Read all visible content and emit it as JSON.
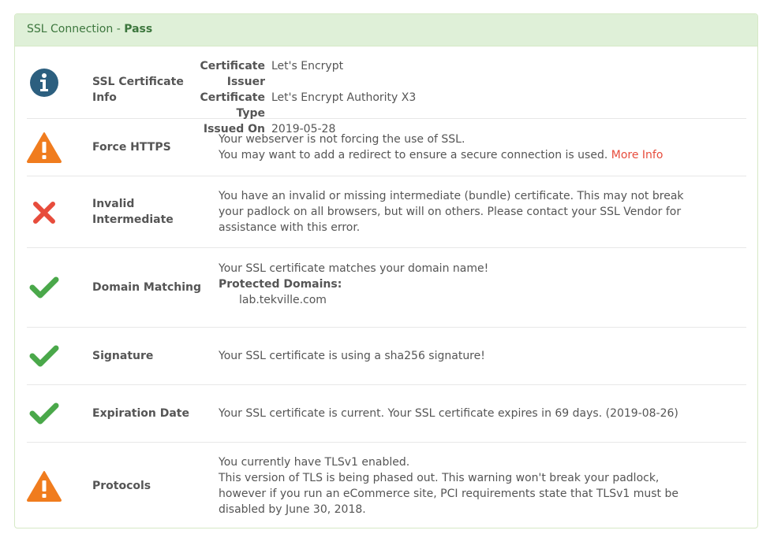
{
  "panel": {
    "title": "SSL Connection -",
    "status": "Pass"
  },
  "colors": {
    "info": "#2c5f7f",
    "warning": "#f07c1e",
    "error": "#e74c3c",
    "success": "#4aa84a",
    "link": "#e74c3c"
  },
  "rows": {
    "cert_info": {
      "icon": "info-icon",
      "label": "SSL Certificate Info",
      "fields": {
        "issuer_key": "Certificate Issuer",
        "issuer_value": "Let's Encrypt",
        "type_key": "Certificate Type",
        "type_value": "Let's Encrypt Authority X3",
        "issued_key": "Issued On",
        "issued_value": "2019-05-28"
      }
    },
    "force_https": {
      "icon": "warning-icon",
      "label": "Force HTTPS",
      "line1": "Your webserver is not forcing the use of SSL.",
      "line2": "You may want to add a redirect to ensure a secure connection is used.",
      "link": "More Info"
    },
    "intermediate": {
      "icon": "error-x-icon",
      "label": "Invalid Intermediate",
      "text": "You have an invalid or missing intermediate (bundle) certificate. This may not break your padlock on all browsers, but will on others. Please contact your SSL Vendor for assistance with this error."
    },
    "domain": {
      "icon": "checkmark-icon",
      "label": "Domain Matching",
      "line1": "Your SSL certificate matches your domain name!",
      "domains_heading": "Protected Domains:",
      "domain": "lab.tekville.com"
    },
    "signature": {
      "icon": "checkmark-icon",
      "label": "Signature",
      "text": "Your SSL certificate is using a sha256 signature!"
    },
    "expiration": {
      "icon": "checkmark-icon",
      "label": "Expiration Date",
      "text": "Your SSL certificate is current. Your SSL certificate expires in 69 days. (2019-08-26)"
    },
    "protocols": {
      "icon": "warning-icon",
      "label": "Protocols",
      "line1": "You currently have TLSv1 enabled.",
      "line2": "This version of TLS is being phased out. This warning won't break your padlock, however if you run an eCommerce site, PCI requirements state that TLSv1 must be disabled by June 30, 2018."
    }
  }
}
